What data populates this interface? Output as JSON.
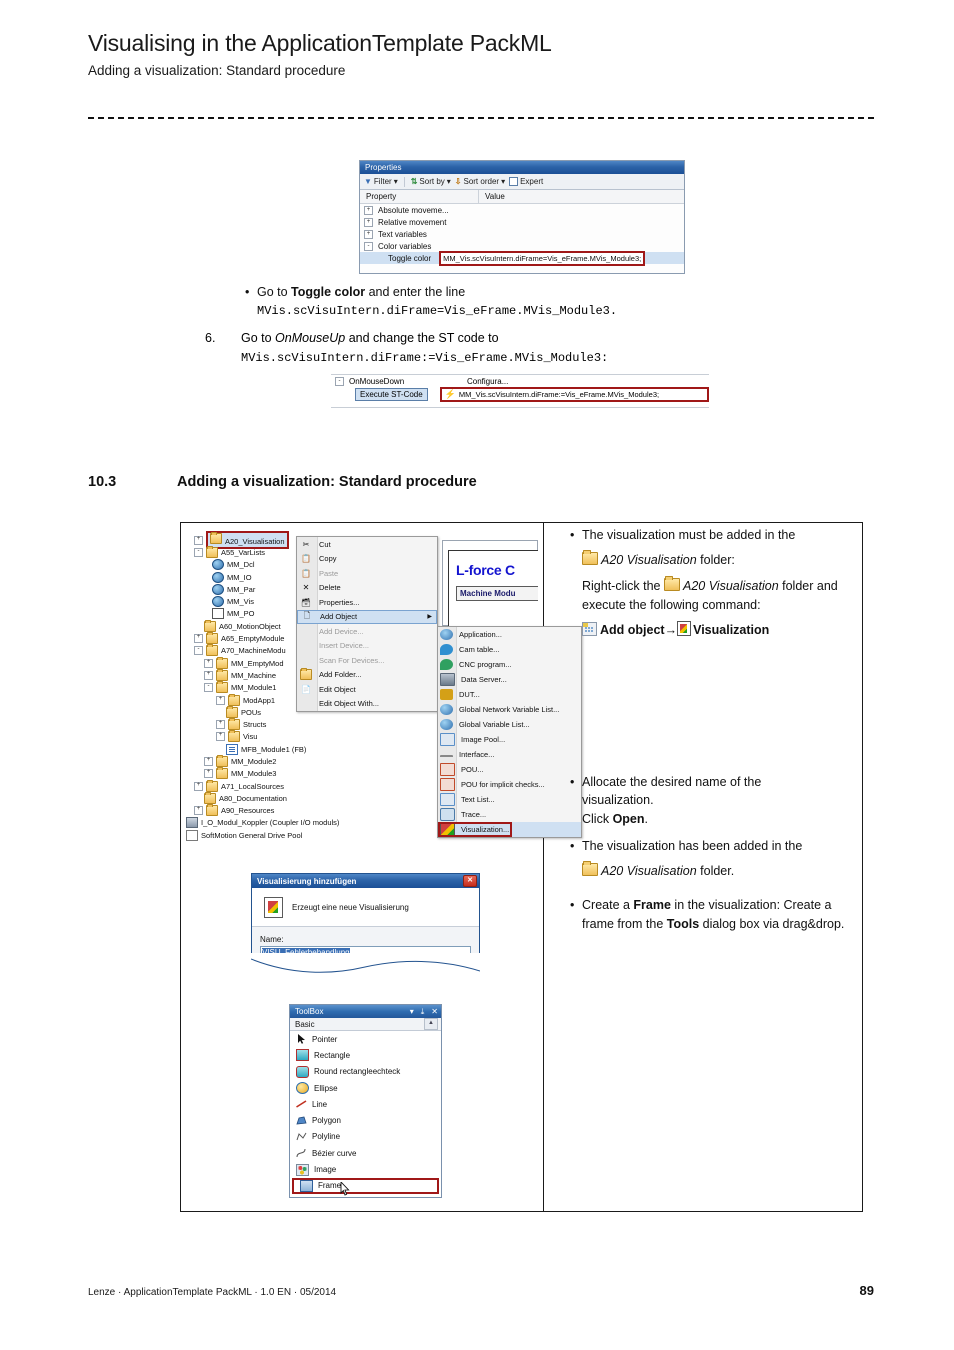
{
  "header": {
    "title": "Visualising in the ApplicationTemplate PackML",
    "subtitle": "Adding a visualization: Standard procedure"
  },
  "properties_window": {
    "title": "Properties",
    "toolbar": {
      "filter": "Filter",
      "sort_by": "Sort by",
      "sort_order": "Sort order",
      "expert": "Expert"
    },
    "columns": [
      "Property",
      "Value"
    ],
    "rows": [
      {
        "toggle": "+",
        "name": "Absolute  moveme...",
        "value": ""
      },
      {
        "toggle": "+",
        "name": "Relative movement",
        "value": ""
      },
      {
        "toggle": "+",
        "name": "Text variables",
        "value": ""
      },
      {
        "toggle": "-",
        "name": "Color variables",
        "value": ""
      }
    ],
    "selected_row": {
      "name": "Toggle color",
      "value": "MM_Vis.scVisuIntern.diFrame=Vis_eFrame.MVis_Module3;"
    }
  },
  "toggle_bullet": {
    "dot": "•",
    "text_pre": "Go to ",
    "text_bold": "Toggle color",
    "text_post": " and enter the line",
    "code": "MVis.scVisuIntern.diFrame=Vis_eFrame.MVis_Module3."
  },
  "step6": {
    "number": "6.",
    "text_pre": "Go to ",
    "text_italic": "OnMouseUp",
    "text_post": " and change the ST code to",
    "code": "MVis.scVisuIntern.diFrame:=Vis_eFrame.MVis_Module3:"
  },
  "mouse_window": {
    "toggle": "-",
    "event": "OnMouseDown",
    "value": "Configura...",
    "action_label": "Execute ST-Code",
    "code": "MM_Vis.scVisuIntern.diFrame:=Vis_eFrame.MVis_Module3;"
  },
  "section": {
    "number": "10.3",
    "title": "Adding a visualization: Standard procedure"
  },
  "ide": {
    "tree": [
      {
        "indent": 1,
        "toggle": "+",
        "icon": "folder-icon",
        "label": "A20_Visualisation",
        "highlight": true
      },
      {
        "indent": 1,
        "toggle": "-",
        "icon": "folder-icon",
        "label": "A55_VarLists"
      },
      {
        "indent": 2,
        "toggle": "",
        "icon": "globe-icon",
        "label": "MM_Dcl"
      },
      {
        "indent": 2,
        "toggle": "",
        "icon": "globe-icon",
        "label": "MM_IO"
      },
      {
        "indent": 2,
        "toggle": "",
        "icon": "globe-icon",
        "label": "MM_Par"
      },
      {
        "indent": 2,
        "toggle": "",
        "icon": "globe-icon",
        "label": "MM_Vis"
      },
      {
        "indent": 2,
        "toggle": "",
        "icon": "persistent-icon",
        "label": "MM_PO"
      },
      {
        "indent": 1,
        "toggle": "",
        "icon": "folder-icon",
        "label": "A60_MotionObject"
      },
      {
        "indent": 1,
        "toggle": "+",
        "icon": "folder-icon",
        "label": "A65_EmptyModule"
      },
      {
        "indent": 1,
        "toggle": "-",
        "icon": "folder-icon",
        "label": "A70_MachineModu"
      },
      {
        "indent": 2,
        "toggle": "+",
        "icon": "folder-icon",
        "label": "MM_EmptyMod"
      },
      {
        "indent": 2,
        "toggle": "+",
        "icon": "folder-icon",
        "label": "MM_Machine"
      },
      {
        "indent": 2,
        "toggle": "-",
        "icon": "folder-icon",
        "label": "MM_Module1"
      },
      {
        "indent": 3,
        "toggle": "+",
        "icon": "folder-icon",
        "label": "ModApp1"
      },
      {
        "indent": 3,
        "toggle": "",
        "icon": "folder-icon",
        "label": "POUs"
      },
      {
        "indent": 3,
        "toggle": "+",
        "icon": "folder-icon",
        "label": "Structs"
      },
      {
        "indent": 3,
        "toggle": "+",
        "icon": "folder-icon",
        "label": "Visu"
      },
      {
        "indent": 3,
        "toggle": "",
        "icon": "function-block-icon",
        "label": "MFB_Module1 (FB)"
      },
      {
        "indent": 2,
        "toggle": "+",
        "icon": "folder-icon",
        "label": "MM_Module2"
      },
      {
        "indent": 2,
        "toggle": "+",
        "icon": "folder-icon",
        "label": "MM_Module3"
      },
      {
        "indent": 1,
        "toggle": "+",
        "icon": "folder-icon",
        "label": "A71_LocalSources"
      },
      {
        "indent": 1,
        "toggle": "",
        "icon": "folder-icon",
        "label": "A80_Documentation"
      },
      {
        "indent": 1,
        "toggle": "+",
        "icon": "folder-icon",
        "label": "A90_Resources"
      },
      {
        "indent": 0,
        "toggle": "",
        "icon": "device-icon",
        "label": "I_O_Modul_Koppler (Coupler I/O moduls)"
      },
      {
        "indent": 0,
        "toggle": "",
        "icon": "drive-pool-icon",
        "label": "SoftMotion General Drive Pool"
      }
    ],
    "context_menu": [
      {
        "label": "Cut",
        "icon": "cut-icon",
        "state": "enabled"
      },
      {
        "label": "Copy",
        "icon": "copy-icon",
        "state": "enabled"
      },
      {
        "label": "Paste",
        "icon": "paste-icon",
        "state": "disabled"
      },
      {
        "label": "Delete",
        "icon": "delete-icon",
        "state": "enabled"
      },
      {
        "label": "Properties...",
        "icon": "properties-icon",
        "state": "enabled"
      },
      {
        "label": "Add Object",
        "icon": "add-object-icon",
        "state": "highlighted",
        "submenu": true
      },
      {
        "label": "Add Device...",
        "icon": "add-device-icon",
        "state": "disabled"
      },
      {
        "label": "Insert Device...",
        "icon": "insert-device-icon",
        "state": "disabled"
      },
      {
        "label": "Scan For Devices...",
        "icon": "scan-devices-icon",
        "state": "disabled"
      },
      {
        "label": "Add Folder...",
        "icon": "folder-icon",
        "state": "enabled"
      },
      {
        "label": "Edit Object",
        "icon": "edit-object-icon",
        "state": "enabled"
      },
      {
        "label": "Edit Object With...",
        "icon": "",
        "state": "enabled"
      }
    ],
    "submenu": [
      {
        "label": "Application...",
        "color": "#3a6fb5"
      },
      {
        "label": "Cam table...",
        "color": "#2f8fd0"
      },
      {
        "label": "CNC program...",
        "color": "#2fa060"
      },
      {
        "label": "Data Server...",
        "color": "#6a7a8a"
      },
      {
        "label": "DUT...",
        "color": "#d4a017"
      },
      {
        "label": "Global Network Variable List...",
        "color": "#2f6fae"
      },
      {
        "label": "Global Variable List...",
        "color": "#2f6fae"
      },
      {
        "label": "Image Pool...",
        "color": "#5a8fc8"
      },
      {
        "label": "Interface...",
        "color": "#888888"
      },
      {
        "label": "POU...",
        "color": "#c04a2a"
      },
      {
        "label": "POU for implicit checks...",
        "color": "#c04a2a"
      },
      {
        "label": "Text List...",
        "color": "#5a8fc8"
      },
      {
        "label": "Trace...",
        "color": "#4a7aa8"
      },
      {
        "label": "Visualization...",
        "color": "#c04a2a",
        "selected": true
      }
    ],
    "preview": {
      "title": "L-force C",
      "button": "Machine Modu"
    }
  },
  "dialog": {
    "title": "Visualisierung hinzufügen",
    "close": "✕",
    "description": "Erzeugt eine neue Visualisierung",
    "name_label": "Name:",
    "name_value": "VISU_Fehlerbehandlung"
  },
  "toolbox": {
    "title": "ToolBox",
    "buttons": [
      "▾",
      "⤓",
      "✕"
    ],
    "category": "Basic",
    "items": [
      {
        "label": "Pointer",
        "icon": "pointer-icon"
      },
      {
        "label": "Rectangle",
        "icon": "rectangle-icon"
      },
      {
        "label": "Round rectangleechteck",
        "icon": "round-rectangle-icon"
      },
      {
        "label": "Ellipse",
        "icon": "ellipse-icon"
      },
      {
        "label": "Line",
        "icon": "line-icon"
      },
      {
        "label": "Polygon",
        "icon": "polygon-icon"
      },
      {
        "label": "Polyline",
        "icon": "polyline-icon"
      },
      {
        "label": "Bézier curve",
        "icon": "bezier-icon"
      },
      {
        "label": "Image",
        "icon": "image-icon"
      },
      {
        "label": "Frame",
        "icon": "frame-icon",
        "selected": true
      }
    ]
  },
  "right_notes": {
    "b1_pre": "The visualization must be added in the",
    "b1_folder": "A20 Visualisation",
    "b1_post": " folder:",
    "b1_rc_pre": "Right-click the ",
    "b1_rc_folder": "A20 Visualisation",
    "b1_rc_post": " folder and execute the following command:",
    "cmd_add": "Add object",
    "cmd_arrow": "→",
    "cmd_vis": "Visualization",
    "b2_l1": "Allocate the desired name of the",
    "b2_l2": "visualization.",
    "b2_l3_pre": "Click ",
    "b2_l3_bold": "Open",
    "b2_l3_post": ".",
    "b3_pre": "The visualization has been added in the",
    "b3_folder": "A20 Visualisation",
    "b3_post": " folder.",
    "b4_pre": "Create a ",
    "b4_bold1": "Frame",
    "b4_mid": " in the visualization: Create a frame from the ",
    "b4_bold2": "Tools",
    "b4_post": " dialog box via drag&drop."
  },
  "footer": {
    "left": "Lenze · ApplicationTemplate PackML · 1.0 EN · 05/2014",
    "page": "89"
  }
}
